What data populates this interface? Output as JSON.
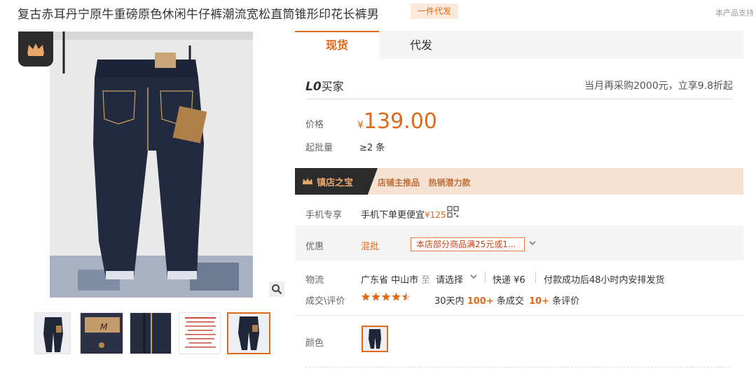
{
  "header": {
    "title": "复古赤耳丹宁原牛重磅原色休闲牛仔裤潮流宽松直筒锥形印花长裤男",
    "dropship_badge": "一件代发",
    "support_text": "本产品支持"
  },
  "tabs": [
    {
      "label": "现货"
    },
    {
      "label": "代发"
    }
  ],
  "buyer": {
    "logo_mark": "L0",
    "logo_text": "买家",
    "promo": "当月再采购2000元，立享9.8折起"
  },
  "price": {
    "label": "价格",
    "currency": "¥",
    "value": "139.00",
    "min_label": "起批量",
    "min_value": "≥2 条"
  },
  "banner": {
    "title": "镇店之宝",
    "text": "店铺主推品   热销潜力款"
  },
  "mobile": {
    "label": "手机专享",
    "text": "手机下单更便宜",
    "price": "¥125"
  },
  "promo": {
    "label": "优惠",
    "kind": "混批",
    "coupon": "本店部分商品满25元或1..."
  },
  "logistics": {
    "label": "物流",
    "from": "广东省 中山市",
    "to": "至",
    "select": "请选择",
    "express": "快递 ¥6",
    "note": "付款成功后48小时内安排发货"
  },
  "deals": {
    "label": "成交\\评价",
    "rating": 4.5,
    "stars": "★★★★★",
    "deal_prefix": "30天内",
    "deal_count": "100+",
    "deal_suffix": "条成交",
    "review_count": "10+",
    "review_suffix": "条评价"
  },
  "color": {
    "label": "颜色"
  },
  "colors": {
    "accent": "#e06a17",
    "banner_bg": "#f5e2d3",
    "dark": "#2b2b2b"
  },
  "icons": {
    "badge": "crown-icon",
    "zoom": "search-icon",
    "qr": "qr-code-icon",
    "dropdown": "chevron-down-icon"
  }
}
